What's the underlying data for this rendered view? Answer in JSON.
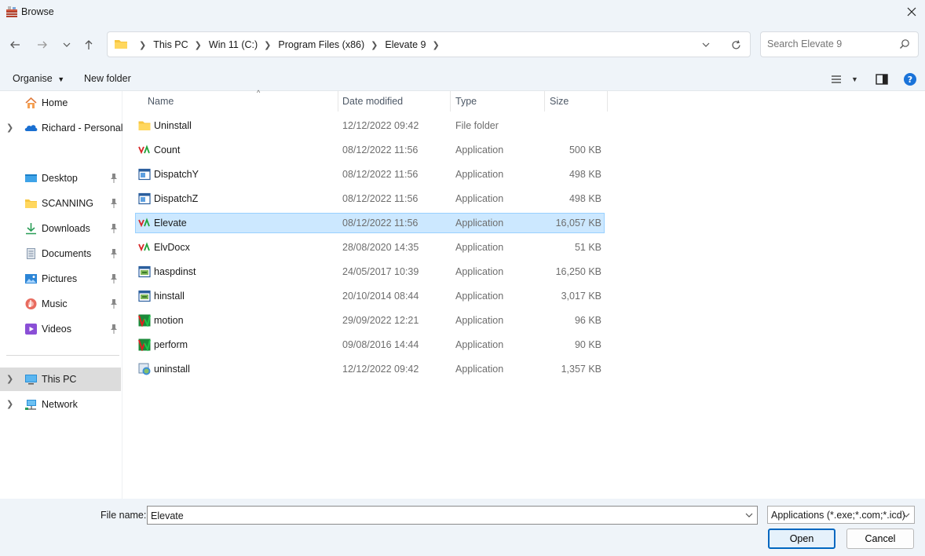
{
  "window": {
    "title": "Browse",
    "close_icon": "close-icon"
  },
  "nav": {
    "back_icon": "arrow-left-icon",
    "forward_icon": "arrow-right-icon",
    "recent_icon": "chevron-down-icon",
    "up_icon": "arrow-up-icon"
  },
  "address": {
    "crumbs": [
      "This PC",
      "Win 11 (C:)",
      "Program Files (x86)",
      "Elevate 9"
    ]
  },
  "search": {
    "placeholder": "Search Elevate 9"
  },
  "commands": {
    "organise": "Organise",
    "new_folder": "New folder"
  },
  "sidebar": {
    "items": [
      {
        "label": "Home",
        "icon": "home-icon"
      },
      {
        "label": "Richard - Personal",
        "icon": "onedrive-icon"
      },
      {
        "label": "Desktop",
        "icon": "desktop-icon"
      },
      {
        "label": "SCANNING",
        "icon": "folder-icon"
      },
      {
        "label": "Downloads",
        "icon": "download-icon"
      },
      {
        "label": "Documents",
        "icon": "documents-icon"
      },
      {
        "label": "Pictures",
        "icon": "pictures-icon"
      },
      {
        "label": "Music",
        "icon": "music-icon"
      },
      {
        "label": "Videos",
        "icon": "videos-icon"
      },
      {
        "label": "This PC",
        "icon": "computer-icon"
      },
      {
        "label": "Network",
        "icon": "network-icon"
      }
    ],
    "selected": "This PC"
  },
  "columns": {
    "name": "Name",
    "date": "Date modified",
    "type": "Type",
    "size": "Size"
  },
  "files": [
    {
      "name": "Uninstall",
      "date": "12/12/2022 09:42",
      "type": "File folder",
      "size": "",
      "icon": "folder-icon"
    },
    {
      "name": "Count",
      "date": "08/12/2022 11:56",
      "type": "Application",
      "size": "500 KB",
      "icon": "elevate-app-icon"
    },
    {
      "name": "DispatchY",
      "date": "08/12/2022 11:56",
      "type": "Application",
      "size": "498 KB",
      "icon": "window-app-icon"
    },
    {
      "name": "DispatchZ",
      "date": "08/12/2022 11:56",
      "type": "Application",
      "size": "498 KB",
      "icon": "window-app-icon"
    },
    {
      "name": "Elevate",
      "date": "08/12/2022 11:56",
      "type": "Application",
      "size": "16,057 KB",
      "icon": "elevate-app-icon"
    },
    {
      "name": "ElvDocx",
      "date": "28/08/2020 14:35",
      "type": "Application",
      "size": "51 KB",
      "icon": "elevate-app-icon"
    },
    {
      "name": "haspdinst",
      "date": "24/05/2017 10:39",
      "type": "Application",
      "size": "16,250 KB",
      "icon": "installer-icon"
    },
    {
      "name": "hinstall",
      "date": "20/10/2014 08:44",
      "type": "Application",
      "size": "3,017 KB",
      "icon": "installer-icon"
    },
    {
      "name": "motion",
      "date": "29/09/2022 12:21",
      "type": "Application",
      "size": "96 KB",
      "icon": "chart-app-icon"
    },
    {
      "name": "perform",
      "date": "09/08/2016 14:44",
      "type": "Application",
      "size": "90 KB",
      "icon": "chart-app-icon"
    },
    {
      "name": "uninstall",
      "date": "12/12/2022 09:42",
      "type": "Application",
      "size": "1,357 KB",
      "icon": "uninstall-icon"
    }
  ],
  "selected_file": "Elevate",
  "bottom": {
    "file_name_label": "File name:",
    "file_name_value": "Elevate",
    "filter": "Applications (*.exe;*.com;*.icd)",
    "open": "Open",
    "cancel": "Cancel"
  }
}
